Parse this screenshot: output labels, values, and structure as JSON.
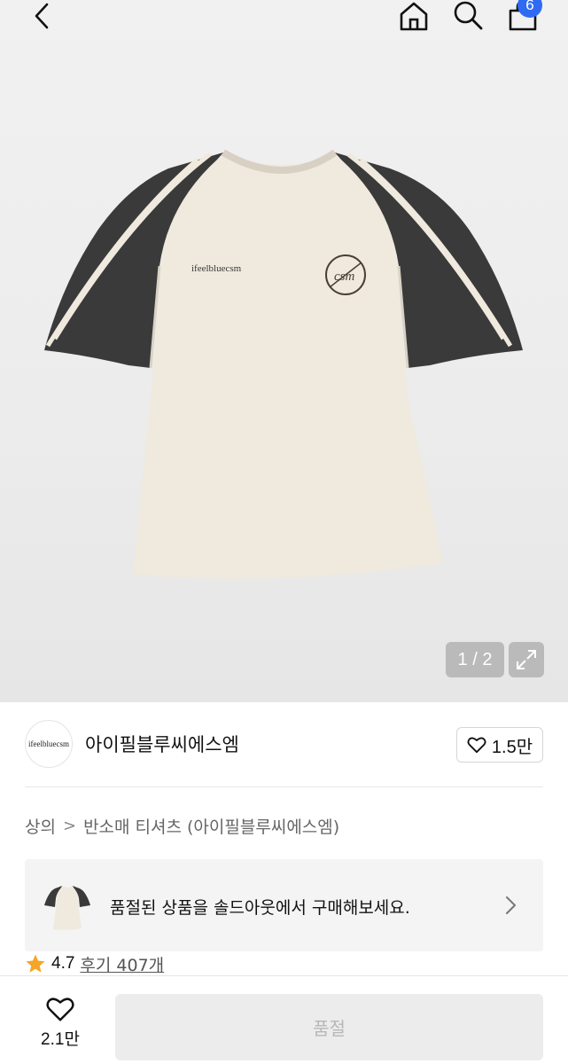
{
  "header": {
    "icons": {
      "back": "chevron-left-icon",
      "home": "home-icon",
      "search": "search-icon",
      "bag": "shopping-bag-icon"
    },
    "bag_badge": "6",
    "badge_color": "#2f6bf2"
  },
  "gallery": {
    "pager": "1 / 2",
    "logo_text": "ifeelbluecsm",
    "emblem_text": "csm"
  },
  "brand": {
    "logo_text": "ifeelbluecsm",
    "name": "아이필블루씨에스엠",
    "like_count": "1.5만"
  },
  "breadcrumb": {
    "category": "상의",
    "separator": ">",
    "product": "반소매 티셔츠 (아이필블루씨에스엠)"
  },
  "soldout_banner": {
    "text": "품절된 상품을 솔드아웃에서 구매해보세요."
  },
  "rating": {
    "value": "4.7",
    "review_label": "후기 407개",
    "star_color": "#f5a623"
  },
  "bottom_bar": {
    "wish_count": "2.1만",
    "buy_label": "품절"
  }
}
